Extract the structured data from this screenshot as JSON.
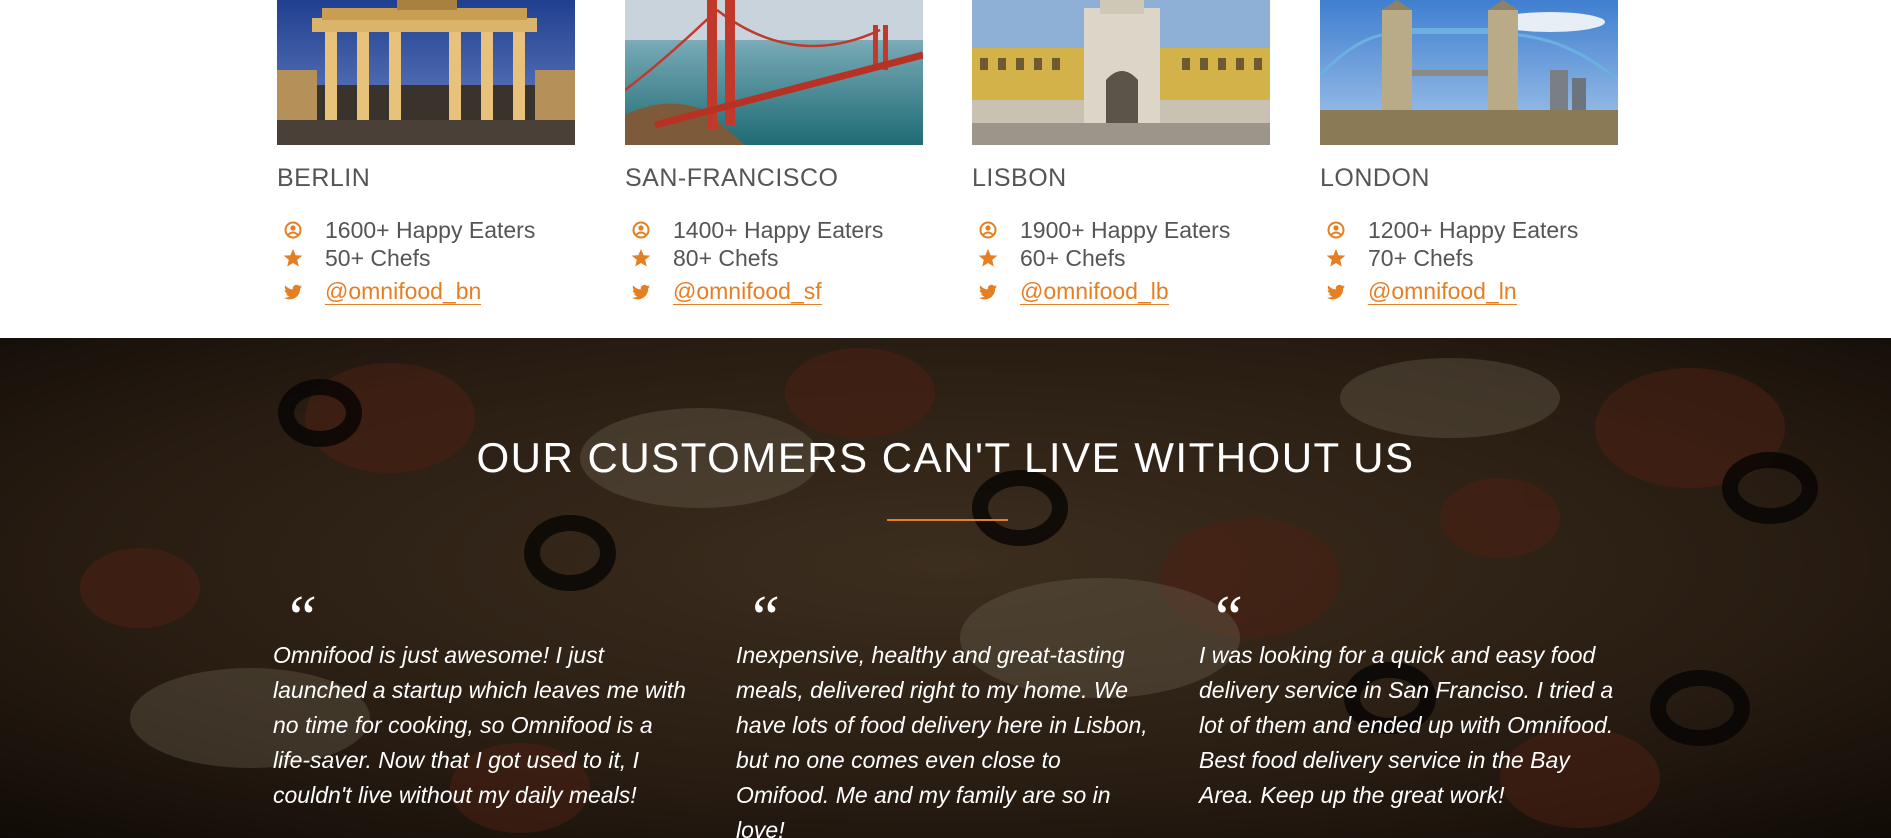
{
  "colors": {
    "accent": "#e67e22",
    "text": "#555555",
    "white": "#ffffff"
  },
  "cities": [
    {
      "name": "BERLIN",
      "eaters": "1600+ Happy Eaters",
      "chefs": "50+ Chefs",
      "twitter": "@omnifood_bn",
      "photo_icon": "berlin-brandenburg-gate-photo"
    },
    {
      "name": "SAN-FRANCISCO",
      "eaters": "1400+ Happy Eaters",
      "chefs": "80+ Chefs",
      "twitter": "@omnifood_sf",
      "photo_icon": "golden-gate-bridge-photo"
    },
    {
      "name": "LISBON",
      "eaters": "1900+ Happy Eaters",
      "chefs": "60+ Chefs",
      "twitter": "@omnifood_lb",
      "photo_icon": "lisbon-arch-photo"
    },
    {
      "name": "LONDON",
      "eaters": "1200+ Happy Eaters",
      "chefs": "70+ Chefs",
      "twitter": "@omnifood_ln",
      "photo_icon": "tower-bridge-photo"
    }
  ],
  "icons": {
    "eaters": "user-circle-icon",
    "chefs": "star-icon",
    "twitter": "twitter-icon"
  },
  "testimonials": {
    "title": "OUR CUSTOMERS CAN'T LIVE WITHOUT US",
    "background": "pizza-photo",
    "quote_mark": "“",
    "items": [
      {
        "text": "Omnifood is just awesome! I just launched a startup which leaves me with no time for cooking, so Omnifood is a life-saver. Now that I got used to it, I couldn't live without my daily meals!"
      },
      {
        "text": "Inexpensive, healthy and great-tasting meals, delivered right to my home. We have lots of food delivery here in Lisbon, but no one comes even close to Omifood. Me and my family are so in love!"
      },
      {
        "text": "I was looking for a quick and easy food delivery service in San Franciso. I tried a lot of them and ended up with Omnifood. Best food delivery service in the Bay Area. Keep up the great work!"
      }
    ]
  }
}
